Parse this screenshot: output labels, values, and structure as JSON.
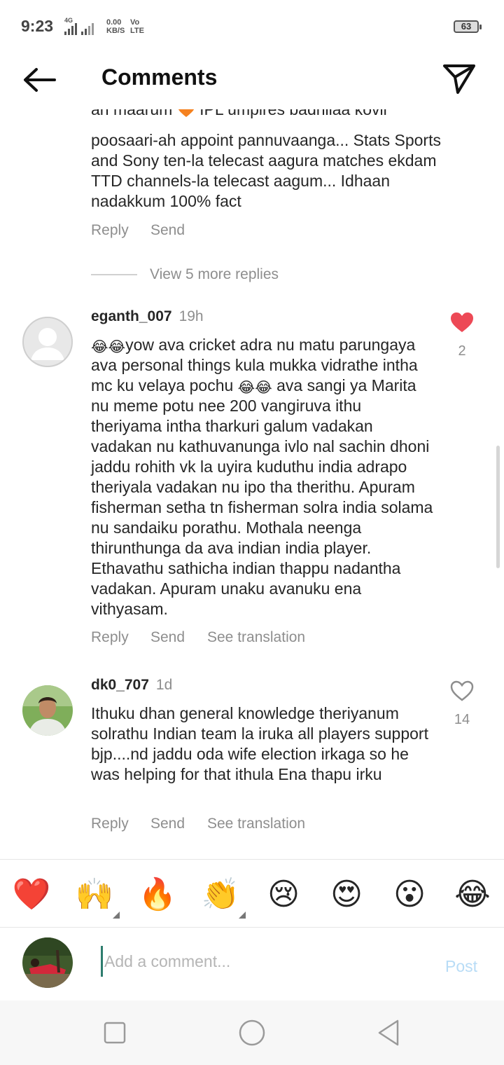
{
  "status_bar": {
    "time": "9:23",
    "network_speed_value": "0.00",
    "network_speed_unit": "KB/S",
    "carrier_top": "Vo",
    "carrier_bottom": "LTE",
    "signal_label": "4G",
    "battery": "63"
  },
  "header": {
    "title": "Comments",
    "back_icon": "arrow-left-icon",
    "share_icon": "paper-plane-icon"
  },
  "partial_comment": {
    "first_line_start": "an maarum",
    "first_line_end": "IPL umpires badhilaa kovil",
    "text": "poosaari-ah appoint pannuvaanga... Stats Sports and Sony ten-la telecast aagura matches ekdam TTD channels-la telecast aagum... Idhaan nadakkum 100% fact",
    "reply": "Reply",
    "send": "Send"
  },
  "view_more_replies": "View 5 more replies",
  "comments": [
    {
      "username": "eganth_007",
      "time": "19h",
      "emoji_start": "😂😂",
      "text_1": "yow ava cricket adra nu matu parungaya ava personal things kula mukka vidrathe intha mc ku velaya pochu ",
      "emoji_mid": "😂😂",
      "text_2": " ava sangi ya Marita nu meme potu nee 200 vangiruva ithu theriyama intha tharkuri galum vadakan vadakan nu kathuvanunga ivlo nal sachin dhoni jaddu rohith vk la uyira kuduthu india adrapo theriyala vadakan nu ipo tha therithu. Apuram fisherman setha tn fisherman solra india solama nu sandaiku porathu. Mothala neenga thirunthunga da ava indian india player. Ethavathu sathicha indian thappu nadantha vadakan. Apuram unaku avanuku ena vithyasam.",
      "likes": "2",
      "liked": true,
      "reply": "Reply",
      "send": "Send",
      "translate": "See translation"
    },
    {
      "username": "dk0_707",
      "time": "1d",
      "text": "Ithuku dhan general knowledge theriyanum solrathu Indian team la iruka all players support bjp....nd jaddu oda wife election irkaga so he was helping for that ithula Ena thapu irku",
      "likes": "14",
      "liked": false,
      "reply": "Reply",
      "send": "Send",
      "translate": "See translation"
    }
  ],
  "reactions": [
    {
      "emoji": "❤️",
      "name": "red-heart"
    },
    {
      "emoji": "🙌",
      "name": "raised-hands"
    },
    {
      "emoji": "🔥",
      "name": "fire"
    },
    {
      "emoji": "👏",
      "name": "clapping-hands"
    },
    {
      "emoji": "😢",
      "name": "crying-face"
    },
    {
      "emoji": "😍",
      "name": "heart-eyes"
    },
    {
      "emoji": "😮",
      "name": "surprised-face"
    },
    {
      "emoji": "😂",
      "name": "tears-of-joy"
    }
  ],
  "comment_input": {
    "placeholder": "Add a comment...",
    "value": "",
    "post": "Post"
  },
  "nav_bar": {
    "recents_icon": "square-icon",
    "home_icon": "circle-icon",
    "back_icon": "triangle-back-icon"
  },
  "colors": {
    "like_red": "#ed4956",
    "secondary_text": "#8e8e8e",
    "post_disabled": "#b8dcf6",
    "primary_text": "#262626"
  }
}
